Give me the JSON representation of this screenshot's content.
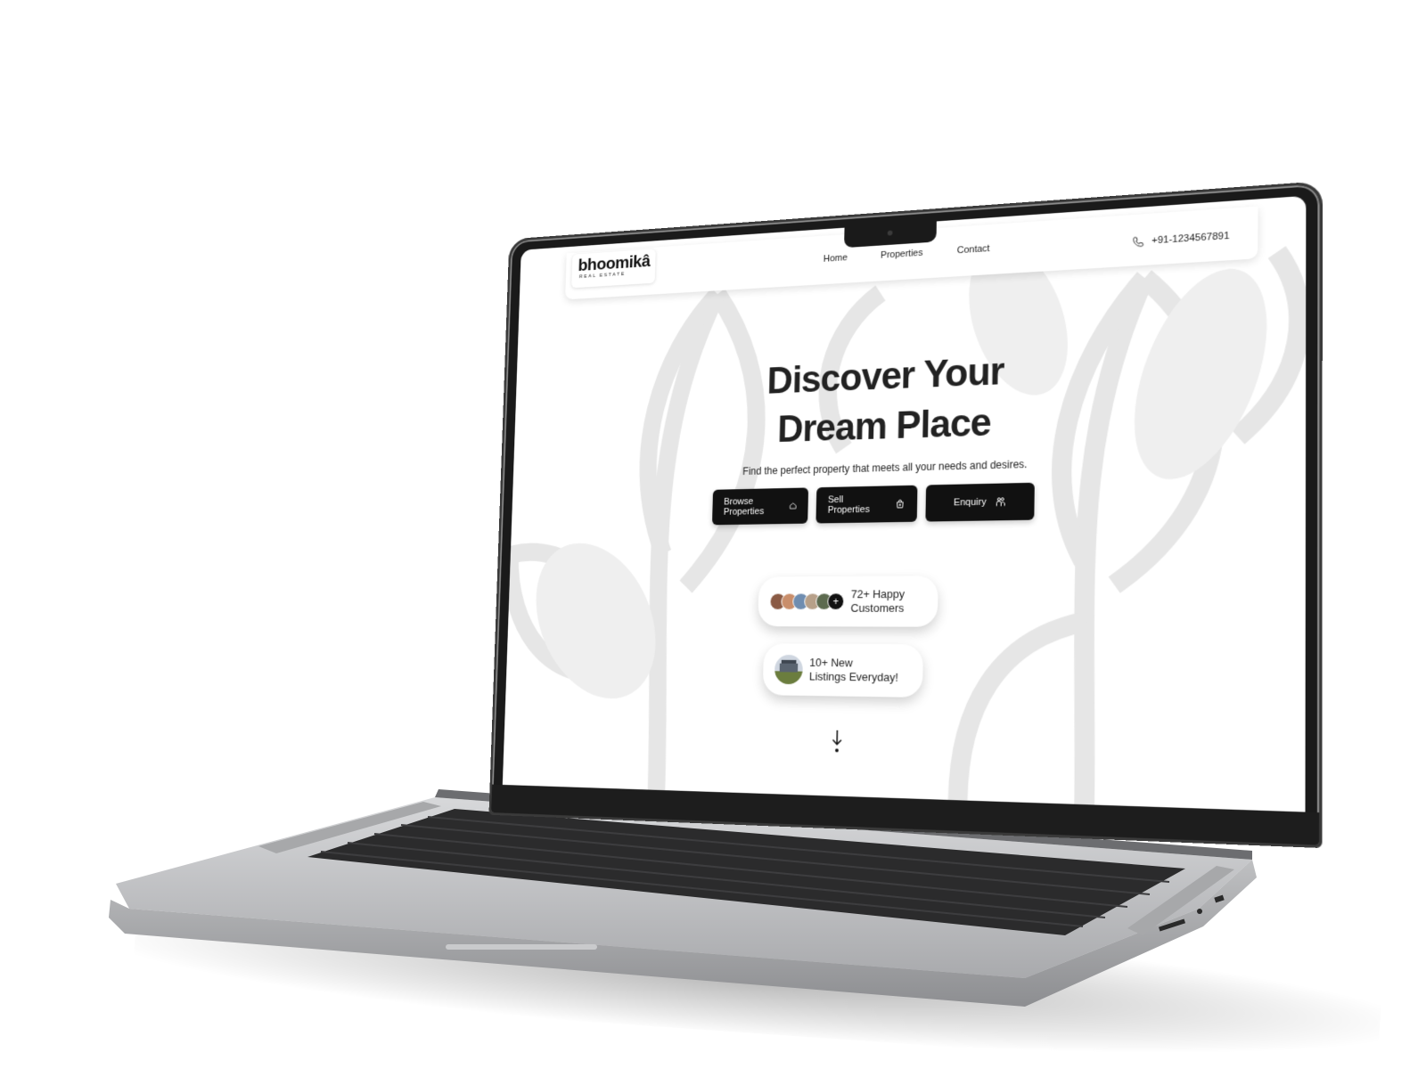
{
  "site": {
    "logo": {
      "name": "bhoomikâ",
      "tagline": "REAL ESTATE"
    },
    "nav": {
      "items": [
        {
          "label": "Home"
        },
        {
          "label": "Properties"
        },
        {
          "label": "Contact"
        }
      ]
    },
    "phone": {
      "number": "+91-1234567891",
      "icon": "phone-icon"
    }
  },
  "hero": {
    "title_line1": "Discover Your",
    "title_line2": "Dream Place",
    "subtitle": "Find the perfect property that meets all your needs and desires.",
    "buttons": [
      {
        "label": "Browse Properties",
        "icon": "house-icon"
      },
      {
        "label": "Sell Properties",
        "icon": "bag-plus-icon"
      },
      {
        "label": "Enquiry",
        "icon": "people-icon"
      }
    ]
  },
  "stats": {
    "customers": {
      "line1": "72+ Happy",
      "line2": "Customers",
      "more_symbol": "+"
    },
    "listings": {
      "line1": "10+ New",
      "line2": "Listings Everyday!"
    }
  },
  "scroll": {
    "icon": "arrow-down-icon"
  },
  "colors": {
    "primary": "#111111",
    "background": "#ffffff",
    "leaf_art": "#e6e6e6",
    "laptop_body": "#bfc0c2"
  }
}
